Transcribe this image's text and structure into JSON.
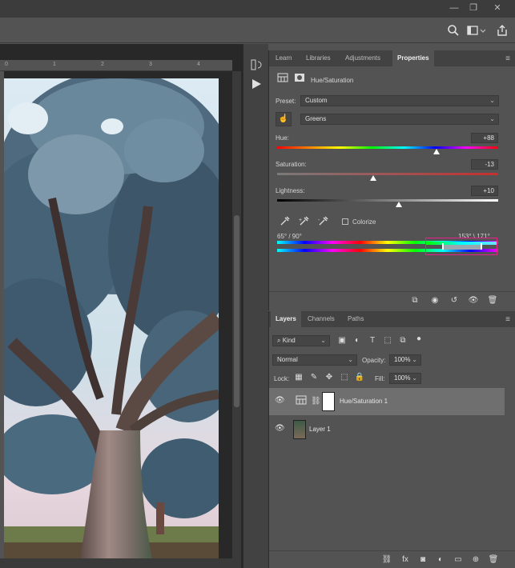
{
  "colors": {
    "accent_border": "#e8208c",
    "hue_handle": "#ffffff"
  },
  "titlebar": {
    "minimize_icon": "minimize-icon",
    "restore_icon": "restore-icon",
    "close_icon": "close-icon"
  },
  "optbar": {
    "search_icon": "search-icon",
    "workspace_icon": "workspace-icon",
    "share_icon": "share-icon"
  },
  "ruler": {
    "ticks": [
      "0",
      "1",
      "2",
      "3",
      "4"
    ]
  },
  "properties_panel": {
    "tabs": [
      "Learn",
      "Libraries",
      "Adjustments",
      "Properties"
    ],
    "active_tab": "Properties",
    "adjustment_title": "Hue/Saturation",
    "preset_label": "Preset:",
    "preset_value": "Custom",
    "channel_value": "Greens",
    "hue_label": "Hue:",
    "hue_value": "+88",
    "hue_level": 0.72,
    "saturation_label": "Saturation:",
    "saturation_value": "-13",
    "saturation_level": 0.435,
    "lightness_label": "Lightness:",
    "lightness_value": "+10",
    "lightness_level": 0.55,
    "colorize_label": "Colorize",
    "colorize_checked": false,
    "range_left_text": "65° / 90°",
    "range_right_text": "153° \\ 171°"
  },
  "layers_panel": {
    "tabs": [
      "Layers",
      "Channels",
      "Paths"
    ],
    "active_tab": "Layers",
    "filter_value": "Kind",
    "blend_mode": "Normal",
    "opacity_label": "Opacity:",
    "opacity_value": "100%",
    "lock_label": "Lock:",
    "fill_label": "Fill:",
    "fill_value": "100%",
    "layers": [
      {
        "name": "Hue/Saturation 1",
        "selected": true
      },
      {
        "name": "Layer 1",
        "selected": false
      }
    ]
  }
}
